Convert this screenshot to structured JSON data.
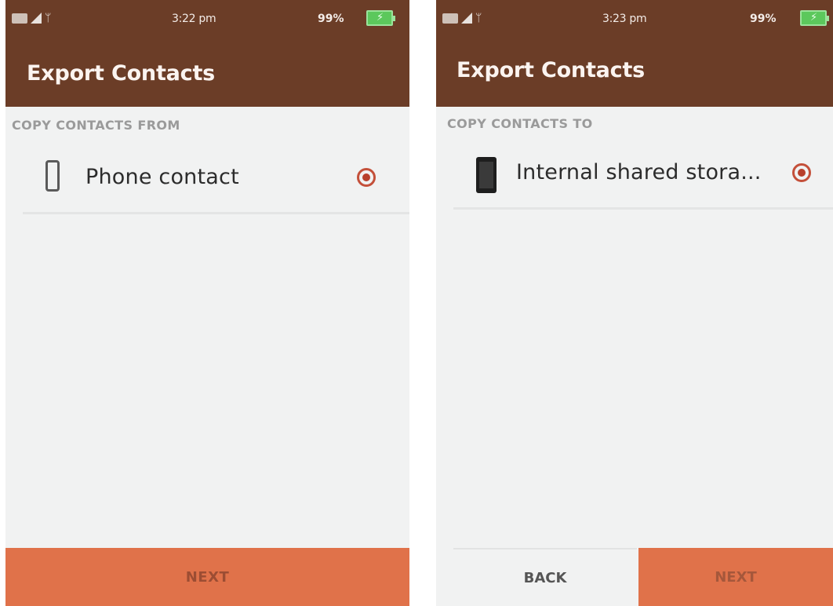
{
  "left_screen": {
    "status_bar": {
      "time": "3:22 pm",
      "battery_percent": "99%",
      "icons": [
        "sim-icon",
        "signal-icon",
        "usb-icon",
        "battery-charging-icon"
      ]
    },
    "title": "Export Contacts",
    "section_header": "COPY CONTACTS FROM",
    "option": {
      "label": "Phone contact",
      "icon": "phone-outline-icon",
      "selected": true
    },
    "next_button_label": "NEXT"
  },
  "right_screen": {
    "status_bar": {
      "time": "3:23 pm",
      "battery_percent": "99%",
      "icons": [
        "sim-icon",
        "signal-icon",
        "usb-icon",
        "battery-charging-icon"
      ]
    },
    "title": "Export Contacts",
    "section_header": "COPY CONTACTS TO",
    "option": {
      "label": "Internal shared stora...",
      "icon": "phone-device-icon",
      "selected": true
    },
    "back_button_label": "BACK",
    "next_button_label": "NEXT"
  },
  "colors": {
    "app_bar": "#6b3d27",
    "accent": "#e0724a",
    "radio_selected": "#c4503a",
    "background": "#f1f2f2",
    "battery": "#5cc85c"
  }
}
